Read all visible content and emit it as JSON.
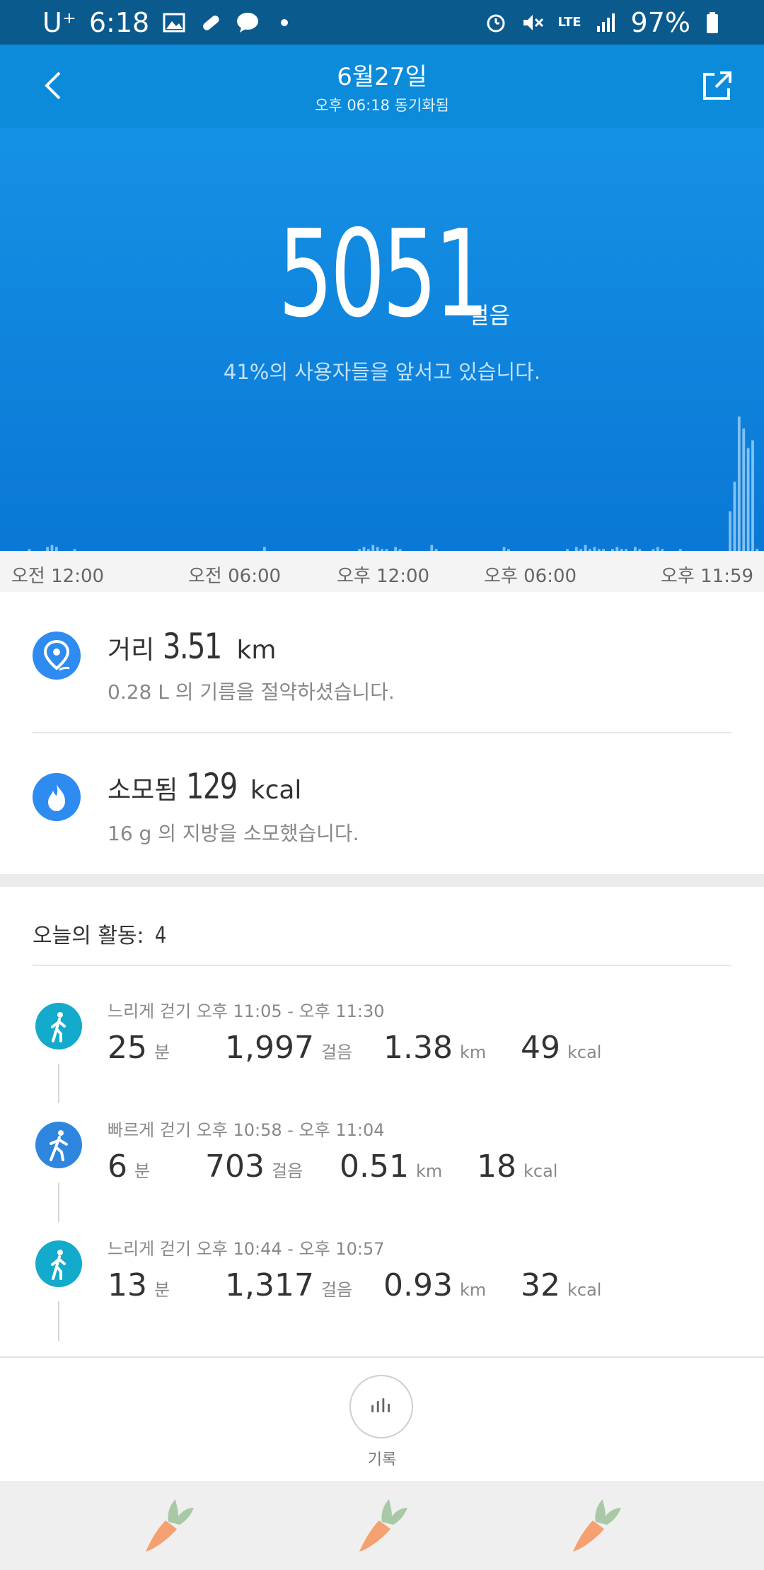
{
  "status_bar": {
    "carrier": "U⁺",
    "time": "6:18",
    "network": "LTE",
    "battery": "97%"
  },
  "header": {
    "title": "6월27일",
    "subtitle": "오후 06:18 동기화됨"
  },
  "hero": {
    "steps": "5051",
    "steps_unit": "걸음",
    "subtext": "41%의 사용자들을 앞서고 있습니다."
  },
  "chart_data": {
    "type": "bar",
    "x_labels": [
      "오전 12:00",
      "오전 06:00",
      "오후 12:00",
      "오후 06:00",
      "오후 11:59"
    ],
    "values": [
      0,
      0,
      0,
      0,
      0,
      0,
      1,
      0,
      0,
      0,
      2,
      3,
      2,
      0,
      0,
      0,
      1,
      0,
      0,
      0,
      0,
      0,
      0,
      0,
      0,
      0,
      0,
      0,
      0,
      0,
      0,
      0,
      0,
      0,
      0,
      0,
      0,
      0,
      0,
      0,
      0,
      0,
      0,
      0,
      0,
      0,
      0,
      0,
      0,
      0,
      0,
      0,
      0,
      0,
      0,
      0,
      0,
      0,
      2,
      0,
      0,
      0,
      0,
      0,
      0,
      0,
      0,
      0,
      0,
      0,
      0,
      0,
      0,
      0,
      0,
      0,
      0,
      0,
      0,
      1,
      2,
      1,
      3,
      2,
      1,
      1,
      0,
      2,
      1,
      0,
      0,
      0,
      0,
      0,
      0,
      3,
      1,
      0,
      0,
      0,
      0,
      0,
      0,
      0,
      0,
      0,
      0,
      0,
      0,
      0,
      0,
      2,
      1,
      0,
      0,
      0,
      0,
      0,
      0,
      0,
      0,
      0,
      0,
      0,
      0,
      1,
      0,
      2,
      1,
      3,
      1,
      2,
      1,
      1,
      0,
      1,
      2,
      1,
      1,
      0,
      2,
      1,
      0,
      0,
      1,
      2,
      1,
      0,
      0,
      0,
      1,
      0,
      0,
      0,
      0,
      0,
      0,
      0,
      0,
      0,
      0,
      20,
      35,
      68,
      62,
      52,
      56,
      1,
      0
    ],
    "grid": false
  },
  "summary": {
    "distance": {
      "label": "거리",
      "value": "3.51",
      "unit": "km",
      "sub": "0.28 L 의 기름을 절약하셨습니다."
    },
    "calories": {
      "label": "소모됨",
      "value": "129",
      "unit": "kcal",
      "sub": "16 g 의 지방을 소모했습니다."
    }
  },
  "activities": {
    "title": "오늘의 활동:",
    "count": "4",
    "items": [
      {
        "label": "느리게 걷기 오후 11:05 - 오후 11:30",
        "color": "#13aacb",
        "min": "25",
        "min_unit": "분",
        "steps": "1,997",
        "steps_unit": "걸음",
        "km": "1.38",
        "km_unit": "km",
        "kcal": "49",
        "kcal_unit": "kcal"
      },
      {
        "label": "빠르게 걷기 오후 10:58 - 오후 11:04",
        "color": "#2f86de",
        "min": "6",
        "min_unit": "분",
        "steps": "703",
        "steps_unit": "걸음",
        "km": "0.51",
        "km_unit": "km",
        "kcal": "18",
        "kcal_unit": "kcal"
      },
      {
        "label": "느리게 걷기 오후 10:44 - 오후 10:57",
        "color": "#13aacb",
        "min": "13",
        "min_unit": "분",
        "steps": "1,317",
        "steps_unit": "걸음",
        "km": "0.93",
        "km_unit": "km",
        "kcal": "32",
        "kcal_unit": "kcal"
      }
    ]
  },
  "bottom": {
    "record_label": "기록"
  }
}
